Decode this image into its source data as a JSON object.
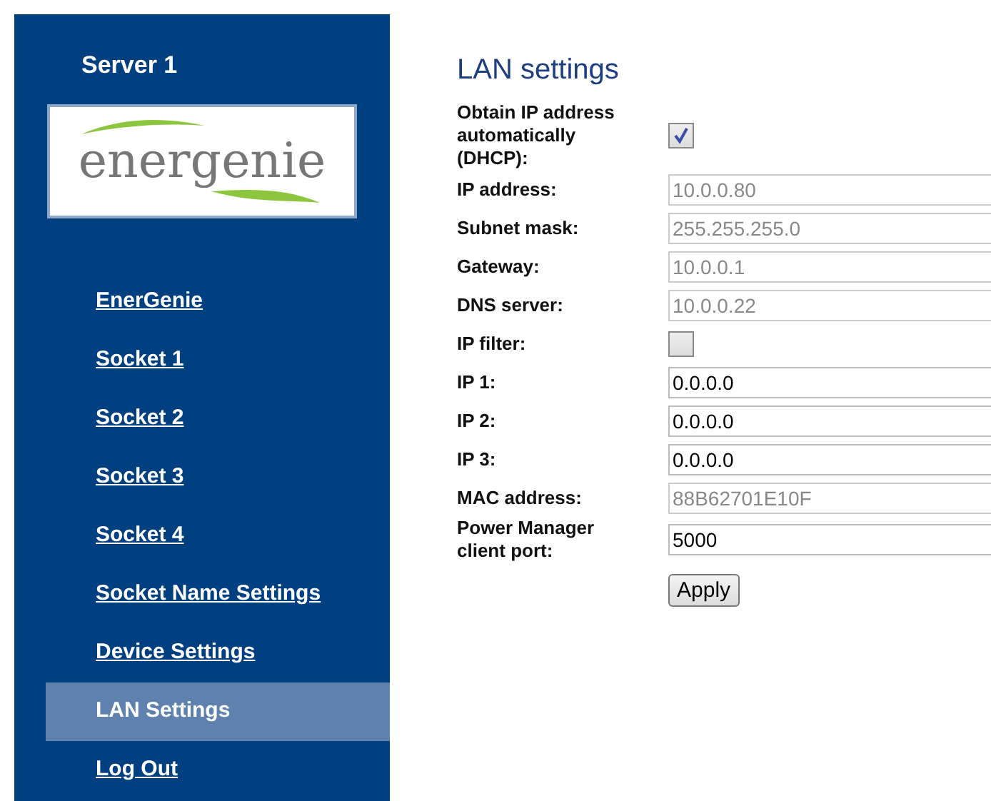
{
  "sidebar": {
    "title": "Server 1",
    "logo": {
      "text": "energenie"
    },
    "items": [
      {
        "label": "EnerGenie",
        "selected": false
      },
      {
        "label": "Socket 1",
        "selected": false
      },
      {
        "label": "Socket 2",
        "selected": false
      },
      {
        "label": "Socket 3",
        "selected": false
      },
      {
        "label": "Socket 4",
        "selected": false
      },
      {
        "label": "Socket Name Settings",
        "selected": false
      },
      {
        "label": "Device Settings",
        "selected": false
      },
      {
        "label": "LAN Settings",
        "selected": true
      },
      {
        "label": "Log Out",
        "selected": false
      }
    ]
  },
  "form": {
    "title": "LAN settings",
    "rows": [
      {
        "kind": "checkbox",
        "label": "Obtain IP address automatically (DHCP):",
        "checked": true
      },
      {
        "kind": "text",
        "label": "IP address:",
        "value": "10.0.0.80",
        "disabled": true
      },
      {
        "kind": "text",
        "label": "Subnet mask:",
        "value": "255.255.255.0",
        "disabled": true
      },
      {
        "kind": "text",
        "label": "Gateway:",
        "value": "10.0.0.1",
        "disabled": true
      },
      {
        "kind": "text",
        "label": "DNS server:",
        "value": "10.0.0.22",
        "disabled": true
      },
      {
        "kind": "checkbox",
        "label": "IP filter:",
        "checked": false
      },
      {
        "kind": "text",
        "label": "IP 1:",
        "value": "0.0.0.0",
        "disabled": false
      },
      {
        "kind": "text",
        "label": "IP 2:",
        "value": "0.0.0.0",
        "disabled": false
      },
      {
        "kind": "text",
        "label": "IP 3:",
        "value": "0.0.0.0",
        "disabled": false
      },
      {
        "kind": "text",
        "label": "MAC address:",
        "value": "88B62701E10F",
        "disabled": true
      },
      {
        "kind": "text",
        "label": "Power Manager client port:",
        "value": "5000",
        "disabled": false
      }
    ],
    "button": "Apply"
  }
}
